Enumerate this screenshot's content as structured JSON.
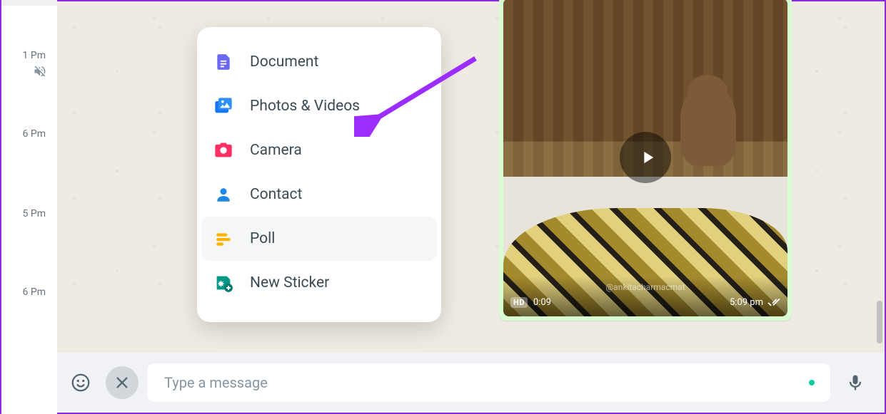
{
  "sidebar": {
    "times": [
      "1 Pm",
      "6 Pm",
      "5 Pm",
      "6 Pm"
    ]
  },
  "menu": {
    "items": [
      {
        "label": "Document"
      },
      {
        "label": "Photos & Videos"
      },
      {
        "label": "Camera"
      },
      {
        "label": "Contact"
      },
      {
        "label": "Poll"
      },
      {
        "label": "New Sticker"
      }
    ]
  },
  "video": {
    "hd_label": "HD",
    "duration": "0:09",
    "caption": "@ankitacharmacmat",
    "time": "5:09 pm"
  },
  "composer": {
    "placeholder": "Type a message"
  }
}
